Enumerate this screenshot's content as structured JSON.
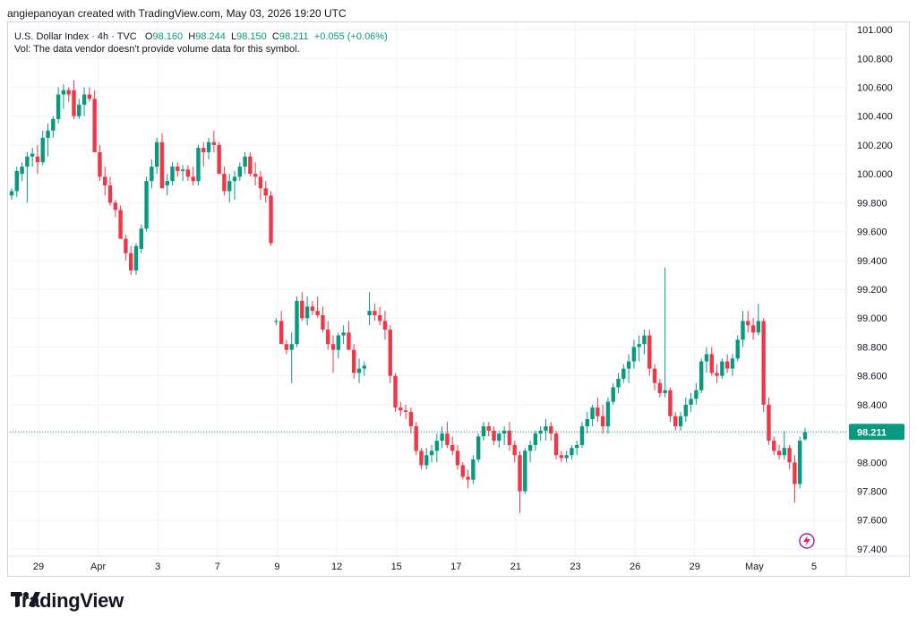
{
  "header": {
    "attribution": "angiepanoyan created with TradingView.com, May 03, 2026 19:20 UTC"
  },
  "legend": {
    "symbol": "U.S. Dollar Index · 4h · TVC",
    "o_label": "O",
    "o_value": "98.160",
    "h_label": "H",
    "h_value": "98.244",
    "l_label": "L",
    "l_value": "98.150",
    "c_label": "C",
    "c_value": "98.211",
    "change": "+0.055 (+0.06%)",
    "vol_note": "Vol: The data vendor doesn't provide volume data for this symbol."
  },
  "footer": {
    "brand": "TradingView"
  },
  "colors": {
    "up": "#089981",
    "down": "#f23645",
    "last_price_bg": "#089981",
    "grid": "#f0f3fa"
  },
  "chart_data": {
    "type": "candlestick",
    "ylim": [
      97.35,
      101.05
    ],
    "yticks": [
      "101.000",
      "100.800",
      "100.600",
      "100.400",
      "100.200",
      "100.000",
      "99.800",
      "99.600",
      "99.400",
      "99.200",
      "99.000",
      "98.800",
      "98.600",
      "98.400",
      "98.200",
      "98.000",
      "97.800",
      "97.600",
      "97.400"
    ],
    "xticks": [
      "29",
      "Apr",
      "3",
      "7",
      "9",
      "12",
      "15",
      "17",
      "21",
      "23",
      "26",
      "29",
      "May",
      "5"
    ],
    "last_price": "98.211",
    "candles": [
      [
        99.85,
        99.9,
        99.82,
        99.88
      ],
      [
        99.88,
        100.05,
        99.84,
        100.02
      ],
      [
        100.0,
        100.08,
        99.95,
        100.05
      ],
      [
        100.05,
        100.15,
        99.8,
        100.12
      ],
      [
        100.12,
        100.18,
        100.05,
        100.14
      ],
      [
        100.12,
        100.2,
        100.0,
        100.08
      ],
      [
        100.08,
        100.3,
        100.06,
        100.25
      ],
      [
        100.25,
        100.35,
        100.12,
        100.3
      ],
      [
        100.3,
        100.4,
        100.25,
        100.38
      ],
      [
        100.38,
        100.6,
        100.35,
        100.55
      ],
      [
        100.55,
        100.62,
        100.45,
        100.58
      ],
      [
        100.58,
        100.6,
        100.5,
        100.55
      ],
      [
        100.58,
        100.65,
        100.38,
        100.4
      ],
      [
        100.4,
        100.52,
        100.38,
        100.48
      ],
      [
        100.48,
        100.6,
        100.4,
        100.55
      ],
      [
        100.55,
        100.6,
        100.5,
        100.52
      ],
      [
        100.52,
        100.58,
        100.2,
        100.15
      ],
      [
        100.15,
        100.2,
        99.95,
        99.98
      ],
      [
        99.98,
        100.05,
        99.85,
        99.92
      ],
      [
        99.92,
        99.98,
        99.78,
        99.8
      ],
      [
        99.8,
        99.82,
        99.7,
        99.75
      ],
      [
        99.75,
        99.78,
        99.55,
        99.55
      ],
      [
        99.55,
        99.58,
        99.4,
        99.45
      ],
      [
        99.45,
        99.5,
        99.3,
        99.33
      ],
      [
        99.33,
        99.52,
        99.3,
        99.5
      ],
      [
        99.48,
        99.65,
        99.45,
        99.62
      ],
      [
        99.62,
        99.98,
        99.6,
        99.95
      ],
      [
        99.95,
        100.1,
        99.9,
        100.05
      ],
      [
        100.05,
        100.25,
        100.0,
        100.22
      ],
      [
        100.22,
        100.28,
        100.05,
        99.9
      ],
      [
        99.92,
        100.0,
        99.85,
        99.95
      ],
      [
        99.95,
        100.08,
        99.92,
        100.05
      ],
      [
        100.05,
        100.08,
        99.98,
        100.02
      ],
      [
        100.02,
        100.06,
        99.95,
        100.03
      ],
      [
        100.03,
        100.06,
        99.95,
        99.98
      ],
      [
        99.98,
        100.05,
        99.92,
        99.95
      ],
      [
        99.95,
        100.2,
        99.92,
        100.18
      ],
      [
        100.18,
        100.22,
        100.05,
        100.15
      ],
      [
        100.15,
        100.25,
        100.1,
        100.22
      ],
      [
        100.22,
        100.3,
        100.15,
        100.2
      ],
      [
        100.2,
        100.22,
        100.05,
        100.0
      ],
      [
        100.0,
        100.05,
        99.85,
        99.88
      ],
      [
        99.88,
        100.0,
        99.8,
        99.95
      ],
      [
        99.95,
        100.02,
        99.82,
        99.98
      ],
      [
        99.98,
        100.08,
        99.95,
        100.05
      ],
      [
        100.05,
        100.15,
        100.0,
        100.12
      ],
      [
        100.12,
        100.15,
        99.98,
        100.0
      ],
      [
        100.0,
        100.08,
        99.92,
        99.98
      ],
      [
        99.98,
        100.02,
        99.82,
        99.9
      ],
      [
        99.9,
        99.95,
        99.8,
        99.85
      ],
      [
        99.85,
        99.88,
        99.5,
        99.52
      ],
      [
        98.98,
        99.0,
        98.95,
        98.98
      ],
      [
        98.98,
        99.05,
        98.9,
        98.82
      ],
      [
        98.82,
        98.85,
        98.75,
        98.78
      ],
      [
        98.78,
        98.9,
        98.55,
        98.82
      ],
      [
        98.82,
        99.15,
        98.8,
        99.12
      ],
      [
        99.12,
        99.18,
        98.98,
        99.0
      ],
      [
        99.0,
        99.15,
        98.95,
        99.08
      ],
      [
        99.08,
        99.12,
        99.02,
        99.05
      ],
      [
        99.05,
        99.15,
        99.0,
        99.02
      ],
      [
        99.02,
        99.08,
        98.9,
        98.92
      ],
      [
        98.92,
        98.98,
        98.78,
        98.82
      ],
      [
        98.82,
        98.88,
        98.62,
        98.78
      ],
      [
        98.78,
        98.9,
        98.72,
        98.88
      ],
      [
        98.88,
        98.95,
        98.82,
        98.9
      ],
      [
        98.9,
        98.98,
        98.85,
        98.78
      ],
      [
        98.78,
        98.82,
        98.58,
        98.62
      ],
      [
        98.62,
        98.72,
        98.55,
        98.65
      ],
      [
        98.65,
        98.7,
        98.6,
        98.67
      ],
      [
        99.02,
        99.18,
        98.95,
        99.05
      ],
      [
        99.05,
        99.1,
        98.98,
        99.02
      ],
      [
        99.02,
        99.08,
        98.95,
        98.98
      ],
      [
        98.98,
        99.05,
        98.85,
        98.92
      ],
      [
        98.92,
        98.95,
        98.55,
        98.6
      ],
      [
        98.6,
        98.62,
        98.35,
        98.38
      ],
      [
        98.38,
        98.42,
        98.32,
        98.36
      ],
      [
        98.36,
        98.4,
        98.3,
        98.35
      ],
      [
        98.35,
        98.38,
        98.2,
        98.25
      ],
      [
        98.25,
        98.28,
        98.05,
        98.08
      ],
      [
        98.08,
        98.1,
        97.95,
        97.98
      ],
      [
        97.98,
        98.1,
        97.95,
        98.05
      ],
      [
        98.05,
        98.12,
        98.0,
        98.08
      ],
      [
        98.08,
        98.2,
        98.0,
        98.15
      ],
      [
        98.15,
        98.25,
        98.1,
        98.2
      ],
      [
        98.2,
        98.28,
        98.1,
        98.12
      ],
      [
        98.12,
        98.18,
        98.05,
        98.08
      ],
      [
        98.08,
        98.12,
        97.95,
        97.98
      ],
      [
        97.98,
        98.0,
        97.88,
        97.9
      ],
      [
        97.9,
        97.95,
        97.82,
        97.88
      ],
      [
        97.88,
        98.05,
        97.85,
        98.02
      ],
      [
        98.02,
        98.2,
        98.0,
        98.18
      ],
      [
        98.18,
        98.28,
        98.15,
        98.25
      ],
      [
        98.25,
        98.28,
        98.18,
        98.22
      ],
      [
        98.22,
        98.25,
        98.12,
        98.15
      ],
      [
        98.15,
        98.22,
        98.1,
        98.2
      ],
      [
        98.2,
        98.25,
        98.12,
        98.22
      ],
      [
        98.22,
        98.28,
        98.08,
        98.12
      ],
      [
        98.12,
        98.15,
        98.0,
        98.05
      ],
      [
        98.05,
        98.08,
        97.65,
        97.8
      ],
      [
        97.8,
        98.1,
        97.78,
        98.08
      ],
      [
        98.08,
        98.15,
        98.0,
        98.12
      ],
      [
        98.12,
        98.22,
        98.08,
        98.2
      ],
      [
        98.2,
        98.25,
        98.15,
        98.22
      ],
      [
        98.22,
        98.3,
        98.15,
        98.25
      ],
      [
        98.25,
        98.28,
        98.15,
        98.2
      ],
      [
        98.2,
        98.22,
        98.02,
        98.05
      ],
      [
        98.05,
        98.08,
        98.0,
        98.03
      ],
      [
        98.03,
        98.08,
        98.0,
        98.05
      ],
      [
        98.05,
        98.12,
        98.02,
        98.1
      ],
      [
        98.1,
        98.15,
        98.05,
        98.12
      ],
      [
        98.12,
        98.28,
        98.1,
        98.25
      ],
      [
        98.25,
        98.35,
        98.2,
        98.3
      ],
      [
        98.3,
        98.4,
        98.25,
        98.38
      ],
      [
        98.38,
        98.45,
        98.28,
        98.32
      ],
      [
        98.32,
        98.4,
        98.2,
        98.25
      ],
      [
        98.25,
        98.45,
        98.2,
        98.42
      ],
      [
        98.42,
        98.55,
        98.4,
        98.52
      ],
      [
        98.52,
        98.62,
        98.48,
        98.58
      ],
      [
        98.58,
        98.68,
        98.55,
        98.65
      ],
      [
        98.65,
        98.75,
        98.55,
        98.7
      ],
      [
        98.7,
        98.85,
        98.65,
        98.8
      ],
      [
        98.8,
        98.88,
        98.7,
        98.82
      ],
      [
        98.82,
        98.92,
        98.75,
        98.88
      ],
      [
        98.88,
        98.92,
        98.6,
        98.65
      ],
      [
        98.65,
        98.68,
        98.5,
        98.55
      ],
      [
        98.55,
        98.58,
        98.45,
        98.48
      ],
      [
        98.48,
        99.35,
        98.45,
        98.5
      ],
      [
        98.5,
        98.52,
        98.28,
        98.32
      ],
      [
        98.32,
        98.35,
        98.22,
        98.25
      ],
      [
        98.25,
        98.35,
        98.22,
        98.32
      ],
      [
        98.32,
        98.45,
        98.28,
        98.4
      ],
      [
        98.4,
        98.48,
        98.35,
        98.44
      ],
      [
        98.44,
        98.55,
        98.4,
        98.5
      ],
      [
        98.5,
        98.72,
        98.48,
        98.7
      ],
      [
        98.7,
        98.8,
        98.62,
        98.75
      ],
      [
        98.75,
        98.8,
        98.6,
        98.62
      ],
      [
        98.62,
        98.68,
        98.55,
        98.6
      ],
      [
        98.6,
        98.72,
        98.58,
        98.7
      ],
      [
        98.7,
        98.75,
        98.62,
        98.65
      ],
      [
        98.65,
        98.75,
        98.6,
        98.72
      ],
      [
        98.72,
        98.88,
        98.7,
        98.85
      ],
      [
        98.85,
        99.05,
        98.8,
        98.98
      ],
      [
        98.98,
        99.05,
        98.9,
        98.95
      ],
      [
        98.95,
        99.0,
        98.85,
        98.9
      ],
      [
        98.9,
        99.1,
        98.88,
        98.98
      ],
      [
        98.98,
        99.0,
        98.35,
        98.4
      ],
      [
        98.4,
        98.45,
        98.12,
        98.15
      ],
      [
        98.15,
        98.18,
        98.05,
        98.08
      ],
      [
        98.08,
        98.12,
        98.02,
        98.05
      ],
      [
        98.05,
        98.22,
        98.02,
        98.1
      ],
      [
        98.1,
        98.12,
        97.95,
        98.0
      ],
      [
        98.0,
        98.05,
        97.72,
        97.85
      ],
      [
        97.85,
        98.18,
        97.82,
        98.15
      ],
      [
        98.16,
        98.24,
        98.15,
        98.21
      ]
    ]
  }
}
